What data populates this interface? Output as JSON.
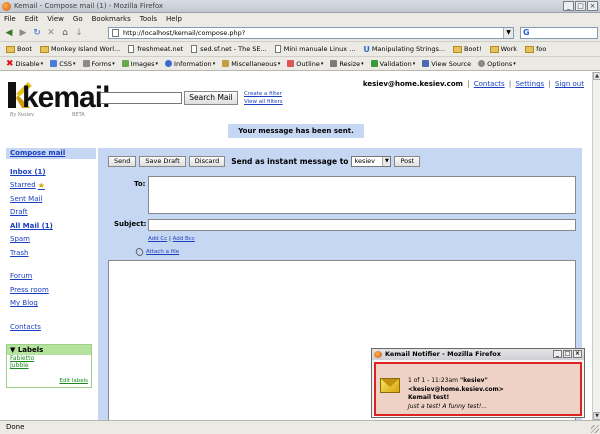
{
  "window": {
    "title": "Kemail - Compose mail (1) - Mozilla Firefox",
    "controls": [
      "_",
      "□",
      "×"
    ]
  },
  "menubar": [
    "File",
    "Edit",
    "View",
    "Go",
    "Bookmarks",
    "Tools",
    "Help"
  ],
  "navigation": {
    "url": "http://localhost/kemail/compose.php?",
    "search_logo": "G"
  },
  "bookmarks": [
    {
      "label": "Boot",
      "icon": "folder-icon"
    },
    {
      "label": "Monkey Island Worl...",
      "icon": "folder-icon"
    },
    {
      "label": "freshmeat.net",
      "icon": "page-icon"
    },
    {
      "label": "sed.sf.net - The SE...",
      "icon": "page-icon"
    },
    {
      "label": "Mini manuale Linux ...",
      "icon": "page-icon"
    },
    {
      "label": "Manipulating Strings...",
      "icon": "u-icon"
    },
    {
      "label": "Boot!",
      "icon": "folder-icon"
    },
    {
      "label": "Work",
      "icon": "folder-icon"
    },
    {
      "label": "foo",
      "icon": "folder-icon"
    }
  ],
  "devtoolbar": [
    "Disable",
    "CSS",
    "Forms",
    "Images",
    "Information",
    "Miscellaneous",
    "Outline",
    "Resize",
    "Validation",
    "View Source",
    "Options"
  ],
  "app": {
    "logo_text": "kemail",
    "logo_by": "By Kesiev",
    "logo_beta": "BETA",
    "search_button": "Search Mail",
    "create_filter": "Create a filter",
    "view_filters": "View all filters",
    "user_email": "kesiev@home.kesiev.com",
    "header_links": [
      "Contacts",
      "Settings",
      "Sign out"
    ],
    "notice": "Your message has been sent."
  },
  "sidebar": {
    "compose": "Compose mail",
    "items": [
      {
        "label": "Inbox (1)",
        "bold": true
      },
      {
        "label": "Starred",
        "star": true
      },
      {
        "label": "Sent Mail"
      },
      {
        "label": "Draft"
      },
      {
        "label": "All Mail (1)",
        "bold": true
      },
      {
        "label": "Spam"
      },
      {
        "label": "Trash"
      }
    ],
    "extra": [
      "Forum",
      "Press room",
      "My Blog"
    ],
    "contacts": "Contacts",
    "labels_title": "Labels",
    "labels": [
      "Fabietto",
      "Jubble"
    ],
    "edit_labels": "Edit labels"
  },
  "compose": {
    "buttons": [
      "Send",
      "Save Draft",
      "Discard"
    ],
    "send_as_label": "Send as instant message to",
    "send_as_value": "kesiev",
    "post_button": "Post",
    "to_label": "To:",
    "subject_label": "Subject:",
    "add_cc": "Add Cc",
    "add_bcc": "Add Bcc",
    "attach": "Attach a file"
  },
  "notifier": {
    "title": "Kemail Notifier - Mozilla Firefox",
    "count": "1 of 1 - 11:23am",
    "sender": "\"kesiev\" <kesiev@home.kesiev.com>",
    "subject": "Kemail test!",
    "preview": "Just a test! A funny test!..."
  },
  "status": "Done"
}
